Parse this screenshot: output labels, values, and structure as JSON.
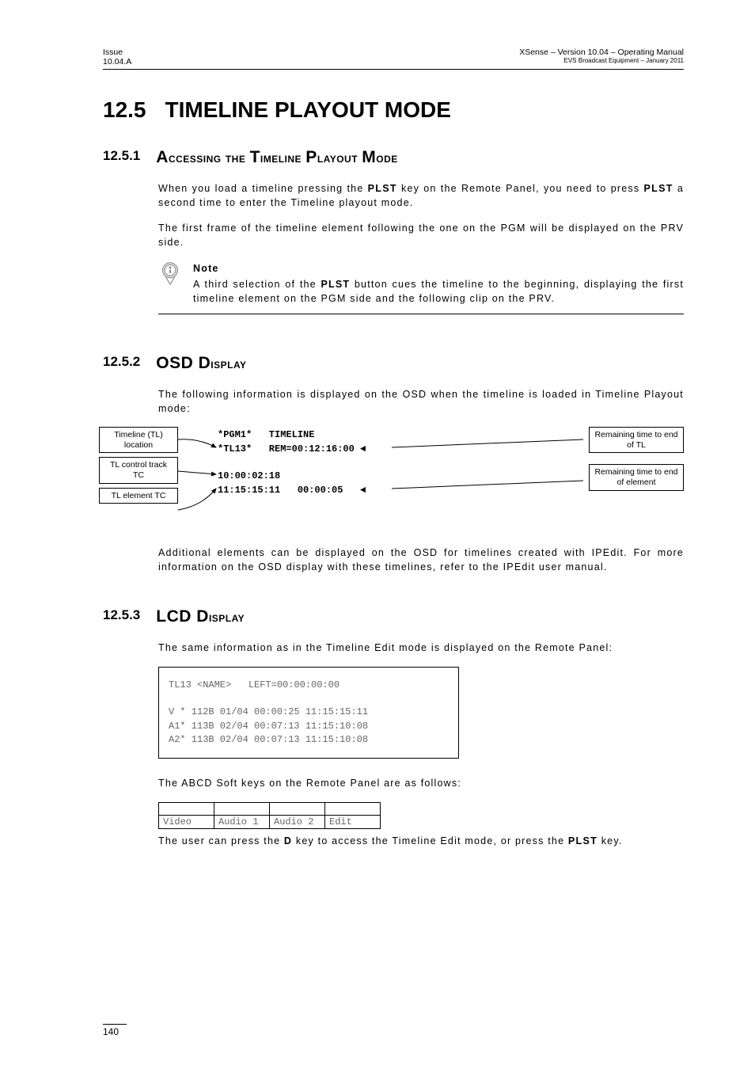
{
  "header": {
    "left_line1": "Issue",
    "left_line2": "10.04.A",
    "right_line1": "XSense – Version 10.04 – Operating Manual",
    "right_line2": "EVS Broadcast Equipment  – January 2011"
  },
  "h1": {
    "num": "12.5",
    "title": "TIMELINE PLAYOUT MODE"
  },
  "s1": {
    "num": "12.5.1",
    "title": "Accessing the Timeline Playout Mode",
    "p1a": "When you load a timeline pressing the ",
    "p1b": "PLST",
    "p1c": " key on the Remote Panel, you need to press ",
    "p1d": "PLST",
    "p1e": " a second time to enter the Timeline playout mode.",
    "p2": "The first frame of the timeline element following the one on the PGM will be displayed on the PRV side.",
    "note_title": "Note",
    "note_a": "A third selection of the ",
    "note_b": "PLST",
    "note_c": " button cues the timeline to the beginning, displaying the first timeline element on the PGM side and the following clip on the PRV."
  },
  "s2": {
    "num": "12.5.2",
    "title": "OSD Display",
    "p1": "The following information is displayed on the OSD when the timeline is loaded in Timeline Playout mode:",
    "label_tl_loc": "Timeline (TL) location",
    "label_tl_ctrl": "TL control track TC",
    "label_tl_elem": "TL element TC",
    "label_rem_tl": "Remaining time to end of TL",
    "label_rem_elem": "Remaining time to end of element",
    "osd_line1": "*PGM1*   TIMELINE",
    "osd_line2": "*TL13*   REM=00:12:16:00",
    "osd_line3": "10:00:02:18",
    "osd_line4": "11:15:15:11   00:00:05",
    "p2": "Additional elements can be displayed on the OSD for timelines created with IPEdit. For more information on the OSD display with these timelines, refer to the IPEdit user manual."
  },
  "s3": {
    "num": "12.5.3",
    "title": "LCD Display",
    "p1": "The same information as in the Timeline Edit mode is displayed on the Remote Panel:",
    "lcd": "TL13 <NAME>   LEFT=00:00:00:00\n\nV * 112B 01/04 00:00:25 11:15:15:11\nA1* 113B 02/04 00:07:13 11:15:10:08\nA2* 113B 02/04 00:07:13 11:15:10:08",
    "p2": "The ABCD Soft keys on the Remote Panel are as follows:",
    "sk": [
      "Video",
      "Audio 1",
      "Audio 2",
      "Edit"
    ],
    "p3a": "The user can press the ",
    "p3b": "D",
    "p3c": " key to access the Timeline Edit mode, or press the ",
    "p3d": "PLST",
    "p3e": " key."
  },
  "page": "140"
}
